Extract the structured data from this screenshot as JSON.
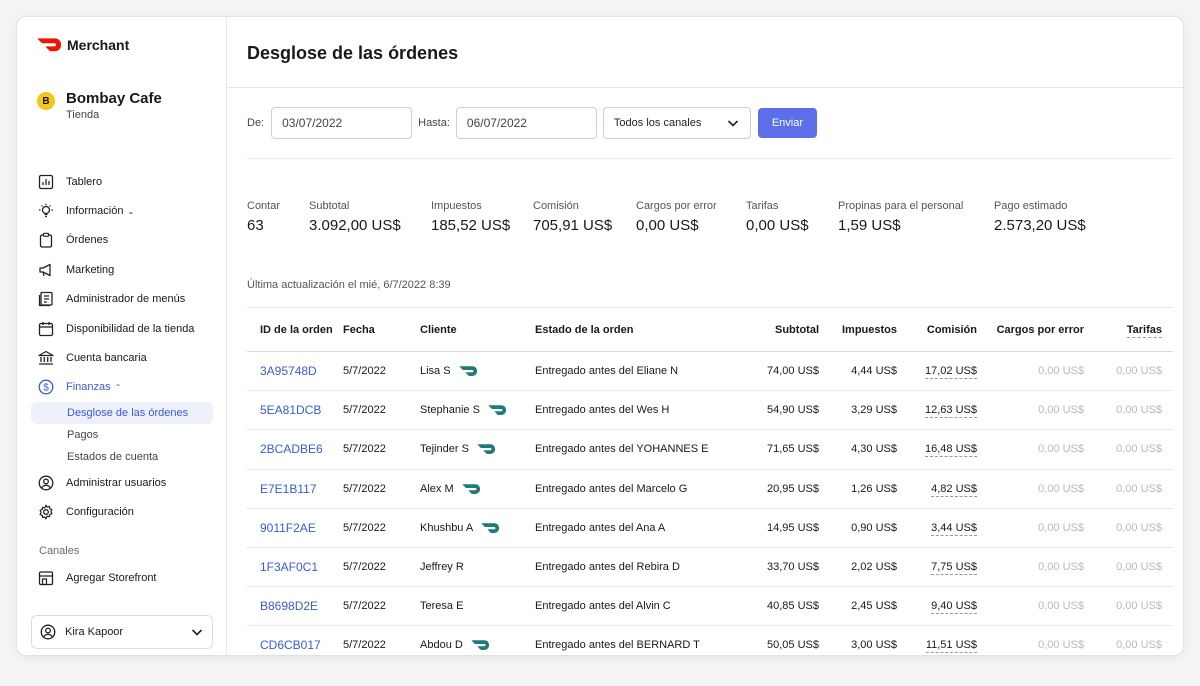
{
  "brand": {
    "name": "Merchant",
    "color": "#eb1700"
  },
  "store": {
    "initial": "B",
    "name": "Bombay Cafe",
    "subtitle": "Tienda"
  },
  "sidebar": {
    "items": [
      {
        "label": "Tablero",
        "icon": "chart-icon"
      },
      {
        "label": "Información",
        "icon": "lightbulb-icon",
        "caret": "⌄"
      },
      {
        "label": "Órdenes",
        "icon": "clipboard-icon"
      },
      {
        "label": "Marketing",
        "icon": "megaphone-icon"
      },
      {
        "label": "Administrador de menús",
        "icon": "menu-book-icon"
      },
      {
        "label": "Disponibilidad de la tienda",
        "icon": "calendar-icon"
      },
      {
        "label": "Cuenta bancaria",
        "icon": "bank-icon"
      },
      {
        "label": "Finanzas",
        "icon": "dollar-circle-icon",
        "caret": "⌃"
      }
    ],
    "finance_sub": [
      {
        "label": "Desglose de las órdenes"
      },
      {
        "label": "Pagos"
      },
      {
        "label": "Estados de cuenta"
      }
    ],
    "items_after": [
      {
        "label": "Administrar usuarios",
        "icon": "user-circle-icon"
      },
      {
        "label": "Configuración",
        "icon": "gear-icon"
      }
    ],
    "channels_label": "Canales",
    "storefront": {
      "label": "Agregar Storefront",
      "icon": "storefront-icon"
    }
  },
  "user": {
    "name": "Kira Kapoor"
  },
  "page": {
    "title": "Desglose de las órdenes"
  },
  "filters": {
    "from_label": "De:",
    "from_value": "03/07/2022",
    "to_label": "Hasta:",
    "to_value": "06/07/2022",
    "channel_value": "Todos los canales",
    "submit_label": "Enviar"
  },
  "stats": [
    {
      "label": "Contar",
      "value": "63"
    },
    {
      "label": "Subtotal",
      "value": "3.092,00 US$"
    },
    {
      "label": "Impuestos",
      "value": "185,52 US$"
    },
    {
      "label": "Comisión",
      "value": "705,91 US$"
    },
    {
      "label": "Cargos por error",
      "value": "0,00 US$"
    },
    {
      "label": "Tarifas",
      "value": "0,00 US$"
    },
    {
      "label": "Propinas para el personal",
      "value": "1,59 US$"
    },
    {
      "label": "Pago estimado",
      "value": "2.573,20 US$"
    }
  ],
  "updated_text": "Última actualización el mié, 6/7/2022 8:39",
  "table": {
    "headers": {
      "id": "ID de la orden",
      "date": "Fecha",
      "client": "Cliente",
      "status": "Estado de la orden",
      "subtotal": "Subtotal",
      "taxes": "Impuestos",
      "commission": "Comisión",
      "errors": "Cargos por error",
      "fees": "Tarifas"
    },
    "rows": [
      {
        "id": "3A95748D",
        "date": "5/7/2022",
        "client": "Lisa S",
        "dasher": true,
        "status": "Entregado antes del Eliane N",
        "subtotal": "74,00 US$",
        "taxes": "4,44 US$",
        "commission": "17,02 US$",
        "errors": "0,00 US$",
        "fees": "0,00 US$"
      },
      {
        "id": "5EA81DCB",
        "date": "5/7/2022",
        "client": "Stephanie S",
        "dasher": true,
        "status": "Entregado antes del Wes H",
        "subtotal": "54,90 US$",
        "taxes": "3,29 US$",
        "commission": "12,63 US$",
        "errors": "0,00 US$",
        "fees": "0,00 US$"
      },
      {
        "id": "2BCADBE6",
        "date": "5/7/2022",
        "client": "Tejinder S",
        "dasher": true,
        "status": "Entregado antes del YOHANNES E",
        "subtotal": "71,65 US$",
        "taxes": "4,30 US$",
        "commission": "16,48 US$",
        "errors": "0,00 US$",
        "fees": "0,00 US$"
      },
      {
        "id": "E7E1B117",
        "date": "5/7/2022",
        "client": "Alex M",
        "dasher": true,
        "status": "Entregado antes del Marcelo G",
        "subtotal": "20,95 US$",
        "taxes": "1,26 US$",
        "commission": "4,82 US$",
        "errors": "0,00 US$",
        "fees": "0,00 US$"
      },
      {
        "id": "9011F2AE",
        "date": "5/7/2022",
        "client": "Khushbu A",
        "dasher": true,
        "status": "Entregado antes del Ana A",
        "subtotal": "14,95 US$",
        "taxes": "0,90 US$",
        "commission": "3,44 US$",
        "errors": "0,00 US$",
        "fees": "0,00 US$"
      },
      {
        "id": "1F3AF0C1",
        "date": "5/7/2022",
        "client": "Jeffrey R",
        "dasher": false,
        "status": "Entregado antes del Rebira D",
        "subtotal": "33,70 US$",
        "taxes": "2,02 US$",
        "commission": "7,75 US$",
        "errors": "0,00 US$",
        "fees": "0,00 US$"
      },
      {
        "id": "B8698D2E",
        "date": "5/7/2022",
        "client": "Teresa E",
        "dasher": false,
        "status": "Entregado antes del Alvin C",
        "subtotal": "40,85 US$",
        "taxes": "2,45 US$",
        "commission": "9,40 US$",
        "errors": "0,00 US$",
        "fees": "0,00 US$"
      },
      {
        "id": "CD6CB017",
        "date": "5/7/2022",
        "client": "Abdou D",
        "dasher": true,
        "status": "Entregado antes del BERNARD T",
        "subtotal": "50,05 US$",
        "taxes": "3,00 US$",
        "commission": "11,51 US$",
        "errors": "0,00 US$",
        "fees": "0,00 US$"
      }
    ]
  },
  "colors": {
    "accent": "#3a5bd9",
    "button": "#5b6fe8",
    "dasher_icon": "#1f7a7a"
  }
}
